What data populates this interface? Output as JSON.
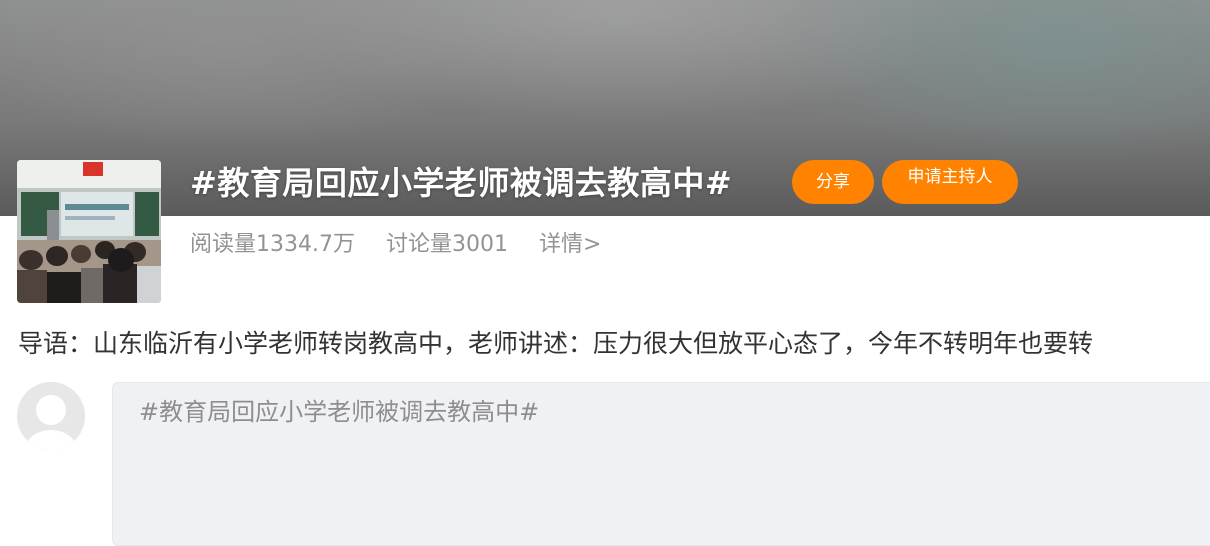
{
  "topic": {
    "title": "#教育局回应小学老师被调去教高中#",
    "cover_icon": "classroom-photo"
  },
  "actions": {
    "share_label": "分享",
    "host_label": "申请主持人"
  },
  "stats": {
    "reads": "阅读量1334.7万",
    "discussions": "讨论量3001",
    "detail_link": "详情>"
  },
  "intro": {
    "text": "导语：山东临沂有小学老师转岗教高中，老师讲述：压力很大但放平心态了，今年不转明年也要转"
  },
  "composer": {
    "text": "#教育局回应小学老师被调去教高中#",
    "avatar_icon": "default-avatar"
  },
  "colors": {
    "accent": "#ff8200",
    "muted": "#939393",
    "composer_bg": "#f0f1f4"
  }
}
